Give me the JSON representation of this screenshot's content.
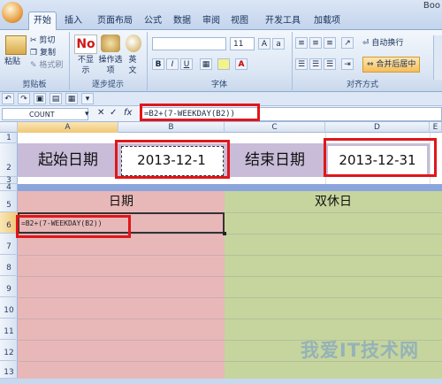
{
  "window_title": "Boo",
  "tabs": [
    "开始",
    "插入",
    "页面布局",
    "公式",
    "数据",
    "审阅",
    "视图",
    "开发工具",
    "加载项"
  ],
  "ribbon": {
    "paste_label": "粘贴",
    "cut_label": "剪切",
    "copy_label": "复制",
    "format_painter_label": "格式刷",
    "clipboard_group": "剪贴板",
    "no_icon_text": "No",
    "not_show_label": "不显示",
    "operation_options_label": "操作选项",
    "english_label": "英文",
    "step_hint_group": "逐步提示",
    "font_size_value": "11",
    "font_group": "字体",
    "bold": "B",
    "italic": "I",
    "underline": "U",
    "wrap_text_label": "自动换行",
    "merge_center_label": "合并后居中",
    "alignment_group": "对齐方式"
  },
  "formula_bar": {
    "name_box": "COUNT",
    "cancel_symbol": "✕",
    "enter_symbol": "✓",
    "fx_symbol": "fx",
    "formula": "=B2+(7-WEEKDAY(B2))"
  },
  "columns": [
    "A",
    "B",
    "C",
    "D",
    "E"
  ],
  "rows": [
    "1",
    "2",
    "3",
    "4",
    "5",
    "6",
    "7",
    "8",
    "9",
    "10",
    "11",
    "12",
    "13"
  ],
  "cells": {
    "start_label": "起始日期",
    "start_date": "2013-12-1",
    "end_label": "结束日期",
    "end_date": "2013-12-31",
    "date_header": "日期",
    "weekend_header": "双休日",
    "editing_formula": "=B2+(7-WEEKDAY(B2))"
  },
  "watermark": "我爱IT技术网",
  "colors": {
    "header_lavender": "#c8bcd8",
    "band_blue": "#8aa4dc",
    "date_column_pink": "#e8b8b8",
    "weekend_column_green": "#c6d59e",
    "annotation_red": "#e0161a"
  }
}
